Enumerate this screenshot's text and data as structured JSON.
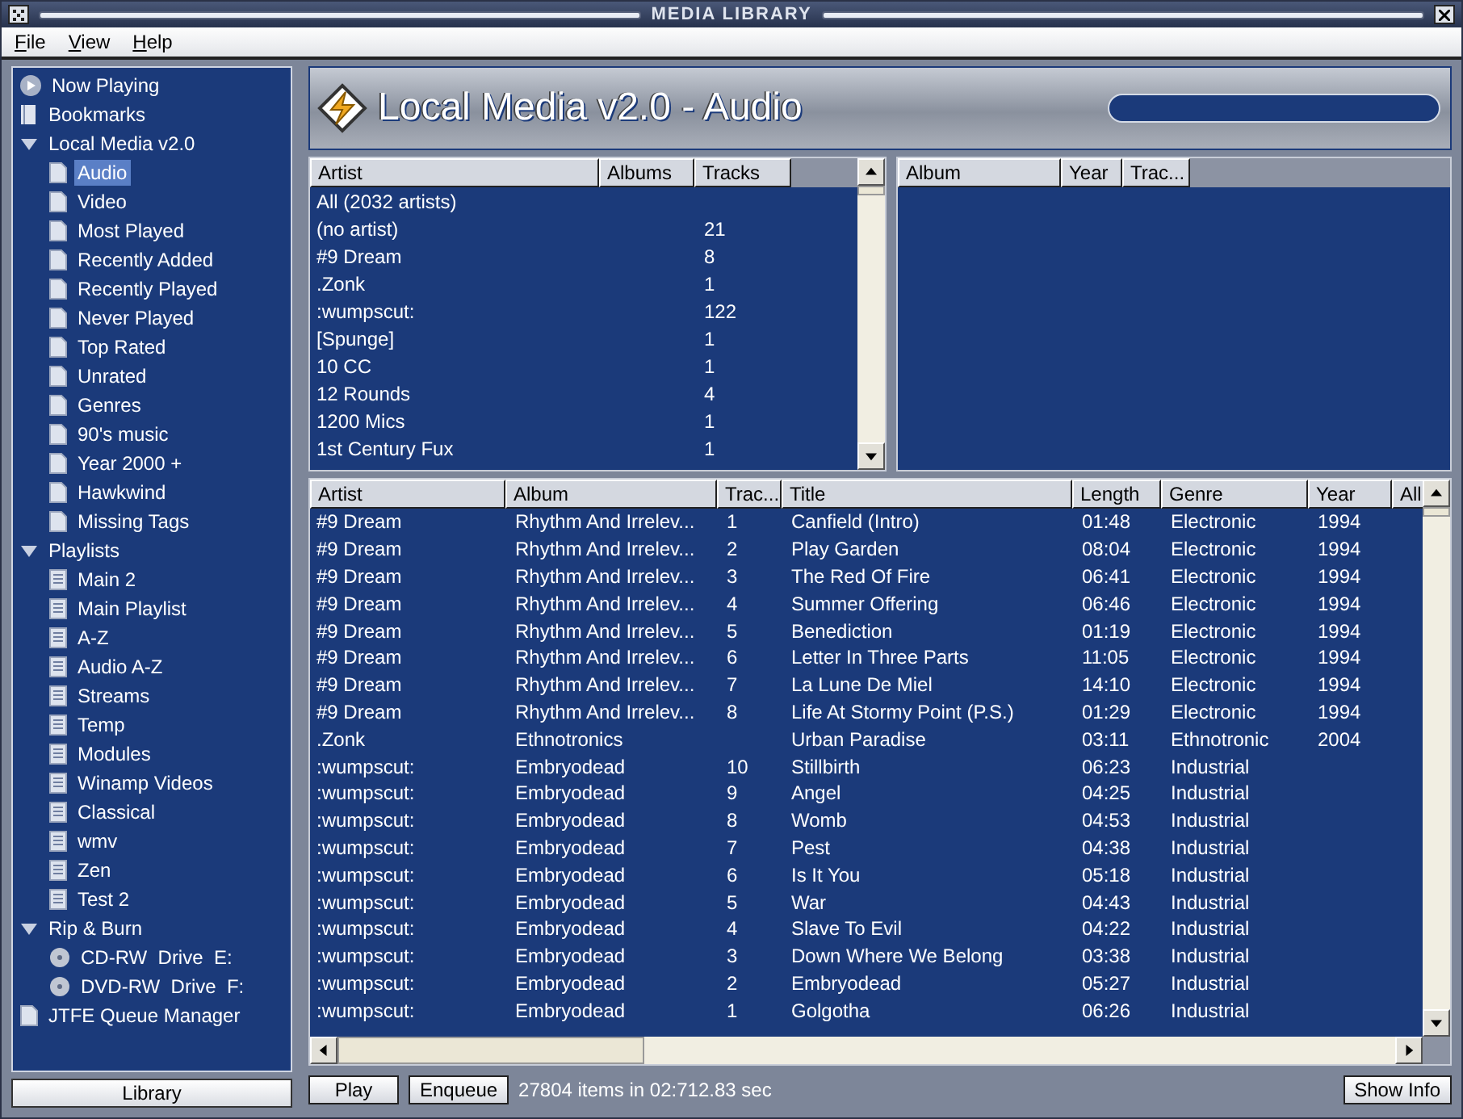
{
  "window": {
    "title": "MEDIA LIBRARY"
  },
  "menu": [
    "File",
    "View",
    "Help"
  ],
  "sidebar": {
    "items": [
      {
        "label": "Now Playing",
        "kind": "play",
        "selected": false
      },
      {
        "label": "Bookmarks",
        "kind": "bookmark",
        "selected": false
      },
      {
        "label": "Local Media v2.0",
        "kind": "group",
        "expanded": true,
        "selected": false,
        "children": [
          {
            "label": "Audio",
            "kind": "view",
            "selected": true
          },
          {
            "label": "Video",
            "kind": "view",
            "selected": false
          },
          {
            "label": "Most Played",
            "kind": "view",
            "selected": false
          },
          {
            "label": "Recently Added",
            "kind": "view",
            "selected": false
          },
          {
            "label": "Recently Played",
            "kind": "view",
            "selected": false
          },
          {
            "label": "Never Played",
            "kind": "view",
            "selected": false
          },
          {
            "label": "Top Rated",
            "kind": "view",
            "selected": false
          },
          {
            "label": "Unrated",
            "kind": "view",
            "selected": false
          },
          {
            "label": "Genres",
            "kind": "view",
            "selected": false
          },
          {
            "label": "90's music",
            "kind": "view",
            "selected": false
          },
          {
            "label": "Year 2000 +",
            "kind": "view",
            "selected": false
          },
          {
            "label": "Hawkwind",
            "kind": "view",
            "selected": false
          },
          {
            "label": "Missing Tags",
            "kind": "view",
            "selected": false
          }
        ]
      },
      {
        "label": "Playlists",
        "kind": "group",
        "expanded": true,
        "selected": false,
        "children": [
          {
            "label": "Main 2",
            "kind": "playlist",
            "selected": false
          },
          {
            "label": "Main Playlist",
            "kind": "playlist",
            "selected": false
          },
          {
            "label": "A-Z",
            "kind": "playlist",
            "selected": false
          },
          {
            "label": "Audio A-Z",
            "kind": "playlist",
            "selected": false
          },
          {
            "label": "Streams",
            "kind": "playlist",
            "selected": false
          },
          {
            "label": "Temp",
            "kind": "playlist",
            "selected": false
          },
          {
            "label": "Modules",
            "kind": "playlist",
            "selected": false
          },
          {
            "label": "Winamp Videos",
            "kind": "playlist",
            "selected": false
          },
          {
            "label": "Classical",
            "kind": "playlist",
            "selected": false
          },
          {
            "label": "wmv",
            "kind": "playlist",
            "selected": false
          },
          {
            "label": "Zen",
            "kind": "playlist",
            "selected": false
          },
          {
            "label": "Test 2",
            "kind": "playlist",
            "selected": false
          }
        ]
      },
      {
        "label": "Rip & Burn",
        "kind": "group",
        "expanded": true,
        "selected": false,
        "children": [
          {
            "label": "CD-RW  Drive  E:",
            "kind": "disc",
            "selected": false
          },
          {
            "label": "DVD-RW  Drive  F:",
            "kind": "disc",
            "selected": false
          }
        ]
      },
      {
        "label": "JTFE Queue Manager",
        "kind": "view",
        "selected": false
      }
    ]
  },
  "library_button": "Library",
  "header": {
    "title": "Local Media v2.0 - Audio"
  },
  "artists": {
    "columns": [
      "Artist",
      "Albums",
      "Tracks"
    ],
    "rows": [
      {
        "artist": "All (2032 artists)"
      },
      {
        "artist": "(no artist)",
        "tracks": "21"
      },
      {
        "artist": "#9 Dream",
        "tracks": "8"
      },
      {
        "artist": ".Zonk",
        "tracks": "1"
      },
      {
        "artist": ":wumpscut:",
        "tracks": "122"
      },
      {
        "artist": "[Spunge]",
        "tracks": "1"
      },
      {
        "artist": "10 CC",
        "tracks": "1"
      },
      {
        "artist": "12 Rounds",
        "tracks": "4"
      },
      {
        "artist": "1200 Mics",
        "tracks": "1"
      },
      {
        "artist": "1st Century Fux",
        "tracks": "1"
      }
    ]
  },
  "albums": {
    "columns": [
      "Album",
      "Year",
      "Trac..."
    ]
  },
  "tracks": {
    "columns": [
      "Artist",
      "Album",
      "Trac...",
      "Title",
      "Length",
      "Genre",
      "Year",
      "All"
    ],
    "rows": [
      {
        "artist": "#9 Dream",
        "album": "Rhythm And Irrelev...",
        "track": "1",
        "title": "Canfield (Intro)",
        "length": "01:48",
        "genre": "Electronic",
        "year": "1994"
      },
      {
        "artist": "#9 Dream",
        "album": "Rhythm And Irrelev...",
        "track": "2",
        "title": "Play Garden",
        "length": "08:04",
        "genre": "Electronic",
        "year": "1994"
      },
      {
        "artist": "#9 Dream",
        "album": "Rhythm And Irrelev...",
        "track": "3",
        "title": "The Red Of Fire",
        "length": "06:41",
        "genre": "Electronic",
        "year": "1994"
      },
      {
        "artist": "#9 Dream",
        "album": "Rhythm And Irrelev...",
        "track": "4",
        "title": "Summer Offering",
        "length": "06:46",
        "genre": "Electronic",
        "year": "1994"
      },
      {
        "artist": "#9 Dream",
        "album": "Rhythm And Irrelev...",
        "track": "5",
        "title": "Benediction",
        "length": "01:19",
        "genre": "Electronic",
        "year": "1994"
      },
      {
        "artist": "#9 Dream",
        "album": "Rhythm And Irrelev...",
        "track": "6",
        "title": "Letter In Three Parts",
        "length": "11:05",
        "genre": "Electronic",
        "year": "1994"
      },
      {
        "artist": "#9 Dream",
        "album": "Rhythm And Irrelev...",
        "track": "7",
        "title": "La Lune De Miel",
        "length": "14:10",
        "genre": "Electronic",
        "year": "1994"
      },
      {
        "artist": "#9 Dream",
        "album": "Rhythm And Irrelev...",
        "track": "8",
        "title": "Life At Stormy Point (P.S.)",
        "length": "01:29",
        "genre": "Electronic",
        "year": "1994"
      },
      {
        "artist": ".Zonk",
        "album": "Ethnotronics",
        "title": "Urban Paradise",
        "length": "03:11",
        "genre": "Ethnotronic",
        "year": "2004"
      },
      {
        "artist": ":wumpscut:",
        "album": "Embryodead",
        "track": "10",
        "title": "Stillbirth",
        "length": "06:23",
        "genre": "Industrial"
      },
      {
        "artist": ":wumpscut:",
        "album": "Embryodead",
        "track": "9",
        "title": "Angel",
        "length": "04:25",
        "genre": "Industrial"
      },
      {
        "artist": ":wumpscut:",
        "album": "Embryodead",
        "track": "8",
        "title": "Womb",
        "length": "04:53",
        "genre": "Industrial"
      },
      {
        "artist": ":wumpscut:",
        "album": "Embryodead",
        "track": "7",
        "title": "Pest",
        "length": "04:38",
        "genre": "Industrial"
      },
      {
        "artist": ":wumpscut:",
        "album": "Embryodead",
        "track": "6",
        "title": "Is It You",
        "length": "05:18",
        "genre": "Industrial"
      },
      {
        "artist": ":wumpscut:",
        "album": "Embryodead",
        "track": "5",
        "title": "War",
        "length": "04:43",
        "genre": "Industrial"
      },
      {
        "artist": ":wumpscut:",
        "album": "Embryodead",
        "track": "4",
        "title": "Slave To Evil",
        "length": "04:22",
        "genre": "Industrial"
      },
      {
        "artist": ":wumpscut:",
        "album": "Embryodead",
        "track": "3",
        "title": "Down Where We Belong",
        "length": "03:38",
        "genre": "Industrial"
      },
      {
        "artist": ":wumpscut:",
        "album": "Embryodead",
        "track": "2",
        "title": "Embryodead",
        "length": "05:27",
        "genre": "Industrial"
      },
      {
        "artist": ":wumpscut:",
        "album": "Embryodead",
        "track": "1",
        "title": "Golgotha",
        "length": "06:26",
        "genre": "Industrial"
      }
    ]
  },
  "footer": {
    "play": "Play",
    "enqueue": "Enqueue",
    "status": "27804 items in 02:712.83 sec",
    "show_info": "Show Info"
  }
}
